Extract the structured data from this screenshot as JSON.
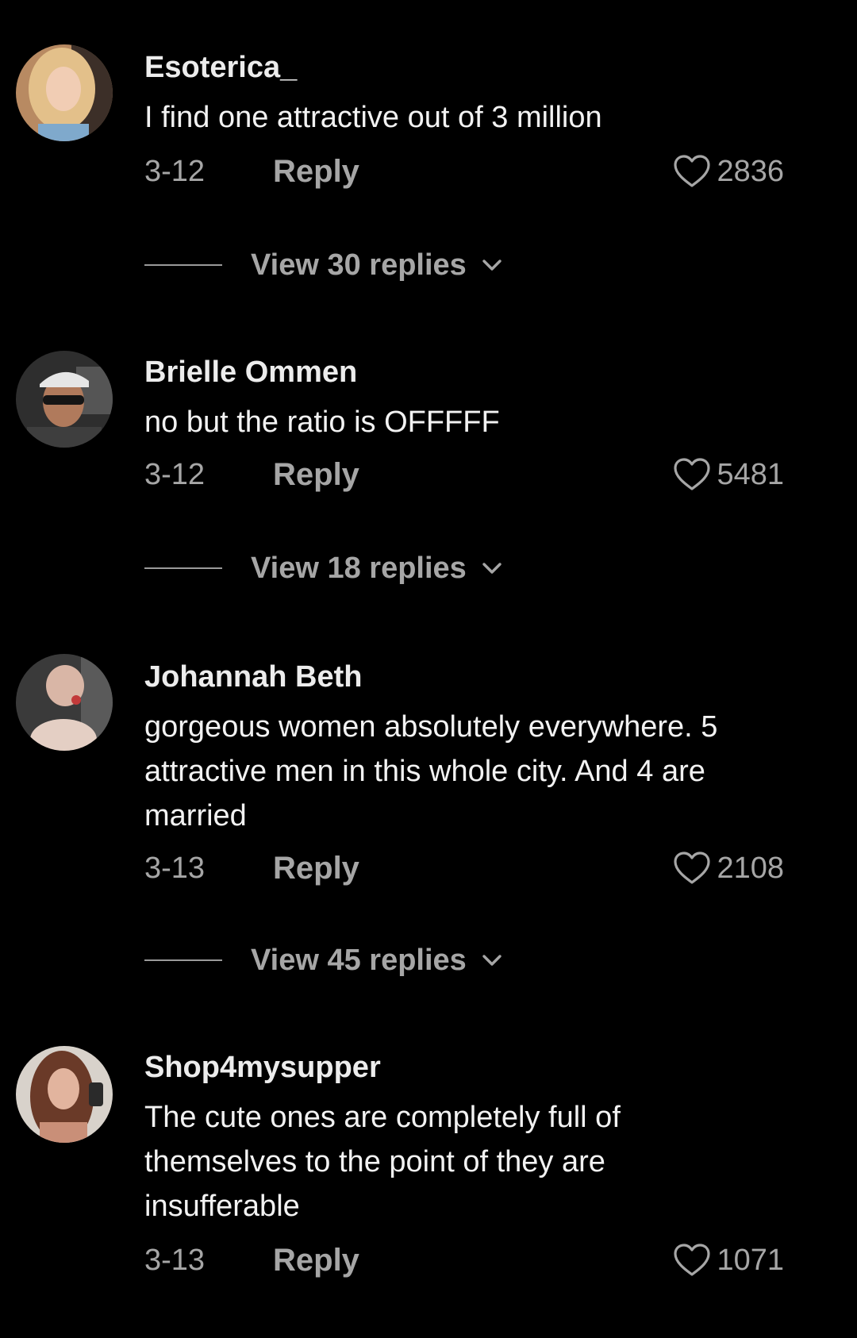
{
  "colors": {
    "background": "#000000",
    "muted": "#a6a6a6",
    "text": "#f2f2f2"
  },
  "comments": [
    {
      "username": "Esoterica_",
      "text": "I find one attractive out of 3 million",
      "date": "3-12",
      "reply_label": "Reply",
      "likes": "2836",
      "like_icon": "heart-outline-icon",
      "view_replies": "View 30 replies"
    },
    {
      "username": "Brielle Ommen",
      "text": "no but the ratio is OFFFFF",
      "date": "3-12",
      "reply_label": "Reply",
      "likes": "5481",
      "like_icon": "heart-outline-icon",
      "view_replies": "View 18 replies"
    },
    {
      "username": "Johannah Beth",
      "text": "gorgeous women absolutely everywhere. 5 attractive men in this whole city. And 4 are married",
      "date": "3-13",
      "reply_label": "Reply",
      "likes": "2108",
      "like_icon": "heart-outline-icon",
      "view_replies": "View 45 replies"
    },
    {
      "username": "Shop4mysupper",
      "text": "The cute ones are completely full of themselves to the point of they are insufferable",
      "date": "3-13",
      "reply_label": "Reply",
      "likes": "1071",
      "like_icon": "heart-outline-icon"
    }
  ]
}
